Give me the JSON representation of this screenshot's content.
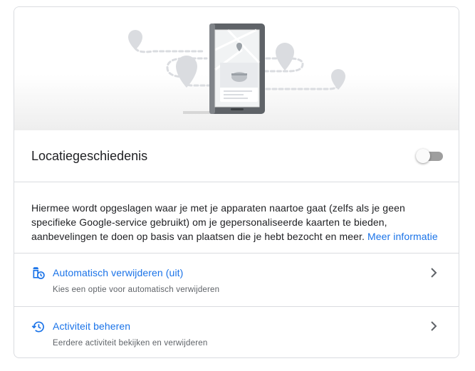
{
  "setting": {
    "title": "Locatiegeschiedenis",
    "toggle_state": "off"
  },
  "description": {
    "text": "Hiermee wordt opgeslagen waar je met je apparaten naartoe gaat (zelfs als je geen specifieke Google-service gebruikt) om je gepersonaliseerde kaarten te bieden, aanbevelingen te doen op basis van plaatsen die je hebt bezocht en meer.",
    "link": "Meer informatie"
  },
  "options": [
    {
      "label": "Automatisch verwijderen (uit)",
      "sublabel": "Kies een optie voor automatisch verwijderen",
      "icon": "auto-delete-icon"
    },
    {
      "label": "Activiteit beheren",
      "sublabel": "Eerdere activiteit bekijken en verwijderen",
      "icon": "history-icon"
    }
  ],
  "colors": {
    "link": "#1a73e8",
    "border": "#dadce0",
    "toggle_track": "#9e9e9e"
  }
}
